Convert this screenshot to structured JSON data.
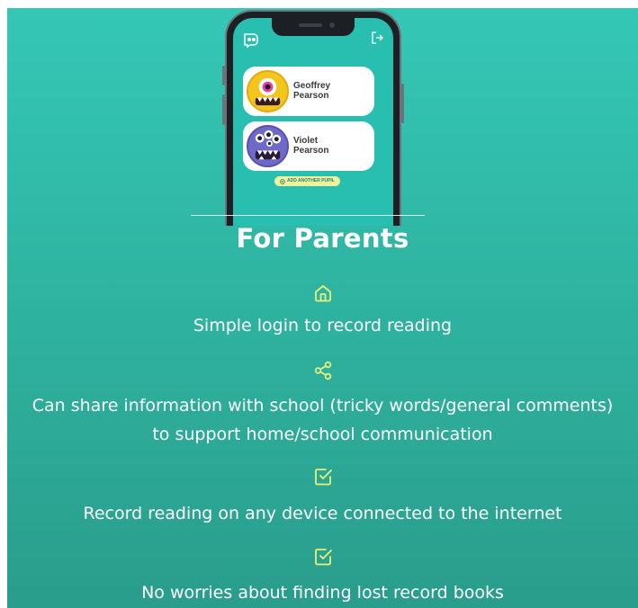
{
  "phone": {
    "pupils": [
      {
        "first_name": "Geoffrey",
        "last_name": "Pearson",
        "avatar": "yellow-one-eyed-monster"
      },
      {
        "first_name": "Violet",
        "last_name": "Pearson",
        "avatar": "purple-multi-eyed-monster"
      }
    ],
    "add_pupil_label": "ADD ANOTHER PUPIL",
    "icons": [
      "app-logo-icon",
      "logout-icon",
      "plus-circle-icon"
    ]
  },
  "section": {
    "title": "For Parents",
    "features": [
      {
        "icon": "home-icon",
        "text": [
          "Simple login to record reading"
        ]
      },
      {
        "icon": "share-icon",
        "text": [
          "Can share information with school (tricky words/general comments)",
          "to support home/school communication"
        ]
      },
      {
        "icon": "checkbox-icon",
        "text": [
          "Record reading on any device connected to the internet"
        ]
      },
      {
        "icon": "checkbox-icon",
        "text": [
          "No worries about finding lost record books"
        ]
      }
    ]
  },
  "colors": {
    "background_top": "#35c7b6",
    "background_bottom": "#2a9d8c",
    "icon_accent": "#e8f07a",
    "text": "#ffffff"
  }
}
